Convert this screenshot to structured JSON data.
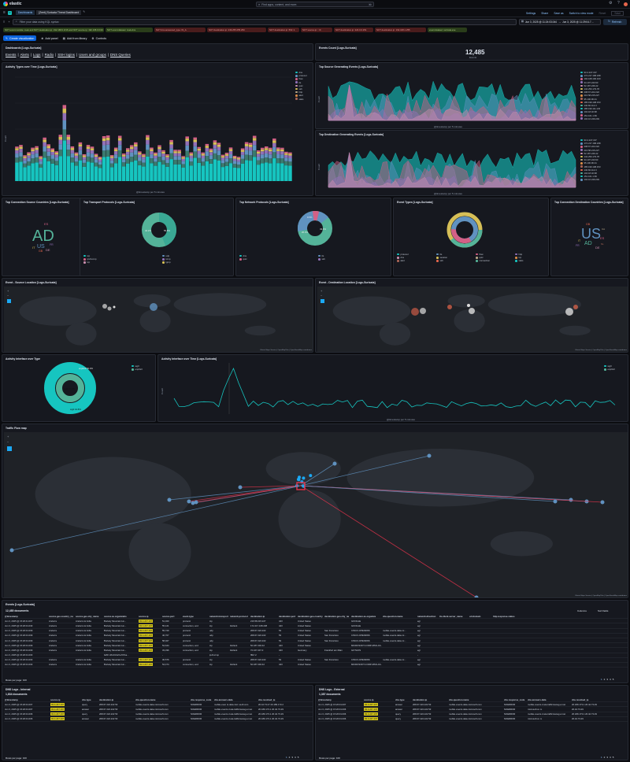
{
  "app": {
    "logo": "elastic",
    "search_placeholder": "Find apps, content, and more.",
    "shortcut": "⌘/"
  },
  "header": {
    "breadcrumb_home": "D",
    "breadcrumb_dashboards": "Dashboards",
    "breadcrumb_current": "[Zeek] Suricata Threat Dashboard",
    "links": [
      "Settings",
      "Share",
      "Save as",
      "Switch to view mode"
    ],
    "reset_label": "Reset",
    "save_label": "Save"
  },
  "query": {
    "placeholder": "Filter your data using KQL syntax",
    "date_start": "Jun 3, 2025 @ 11:24:03.044",
    "date_arrow": "→",
    "date_end": "Jun 3, 2025 @ 11:29:04.7…",
    "refresh_label": "Refresh"
  },
  "filters": [
    "NOT event.module: zeek and NOT destination.ip: 192.168.0.0/16 and NOT source.ip: 192.168.0.0/16",
    "NOT event.dataset: zeek.dns",
    "NOT dns.answered_type: IN_A",
    "NOT destination.ip: 239.255.255.250",
    "NOT destination.ip: ff02::1",
    "NOT source.ip: ::/0",
    "NOT destination.ip: 224.0.0.251",
    "NOT destination.ip: 192.168.1.255",
    "event.dataset: suricata.eve"
  ],
  "toolbar": {
    "create": "Create visualization",
    "add_panel": "Add panel",
    "add_library": "Add from library",
    "controls": "Controls"
  },
  "nav_panel": {
    "title": "Dashboards [Logs-Suricata]",
    "links": [
      "Events",
      "Alerts",
      "Logs",
      "Radio",
      "SSH logins",
      "Users and groups",
      "DNS Queries"
    ]
  },
  "metric_panel": {
    "title": "Events Count [Logs-Suricata]",
    "value": "12,485",
    "label": "Events"
  },
  "activity_panel": {
    "title": "Activity Types over Time [Logs-Suricata]",
    "xlabel": "@timestamp per 5 minutes",
    "ylabel": "Count"
  },
  "src_panel": {
    "title": "Top Source Generating Events [Logs-Suricata]",
    "xlabel": "@timestamp per 5 minutes",
    "ylabel": "Count"
  },
  "dst_panel": {
    "title": "Top Destination Generating Events [Logs-Suricata]",
    "xlabel": "@timestamp per 5 minutes",
    "ylabel": "Count"
  },
  "donuts": [
    {
      "title": "Top Connection Source Countries [Logs-Suricata]",
      "kind": "cloud",
      "words": [
        "AD",
        "US",
        "IT",
        "DE",
        "ES",
        "FR",
        "GB"
      ]
    },
    {
      "title": "Top Transport Protocols [Logs-Suricata]",
      "kind": "pie",
      "legend": [
        "tcp",
        "udp",
        "ipv6-icmp",
        "icmp",
        "tcp",
        "igmp"
      ],
      "center": "42.2%",
      "pct": "55.8%"
    },
    {
      "title": "Top Network Protocols [Logs-Suricata]",
      "kind": "pie",
      "legend": [
        "dns",
        "tls",
        "quic",
        "ssh"
      ],
      "pct1": "26.3%",
      "pct2": "43.4%",
      "pct3": "9.5%"
    },
    {
      "title": "Event Types [Logs-Suricata]",
      "kind": "multi",
      "legend": [
        "protocol",
        "tls",
        "flow",
        "http",
        "dns",
        "session",
        "quic",
        "tcp",
        "alert",
        "ssh",
        "connection",
        "stats"
      ]
    },
    {
      "title": "Top Connection Destination Countries [Logs-Suricata]",
      "kind": "cloud",
      "words": [
        "US",
        "AD",
        "ES",
        "DE",
        "IT",
        "FR",
        "GB",
        "NL",
        "CA"
      ]
    }
  ],
  "maps": [
    {
      "title": "Event - Source Location [Logs-Suricata]",
      "attrib": "Elastic Maps Service | OpenMapTiles | OpenStreetMap contributors"
    },
    {
      "title": "Event - Destination Location [Logs-Suricata]",
      "attrib": "Elastic Maps Service | OpenMapTiles | OpenStreetMap contributors"
    }
  ],
  "interface_panel": {
    "title": "Activity Interface over Type",
    "legend": [
      "wg0",
      "enp0s3"
    ],
    "outer": "enp0s3 52.4%",
    "inner": "wg0 97.2%",
    "big": "wg0 44.8%"
  },
  "interface_time": {
    "title": "Activity Interface over Time [Logs-Suricata]",
    "xlabel": "@timestamp per 5 minutes",
    "ylabel": "Count",
    "legend": [
      "wg0",
      "enp0s3"
    ]
  },
  "traffic_map": {
    "title": "Traffic Flow map",
    "attrib": "Elastic Maps Service | OpenMapTiles | OpenStreetMap contributors"
  },
  "events_table": {
    "title": "Events [Logs-Suricata]",
    "count": "12,485 documents",
    "columns_label": "Columns",
    "sort_label": "Sort fields",
    "headers": [
      "@timestamp",
      "source.geo.country_na",
      "source.geo.city_name",
      "source.as.organizatio",
      "source.ip",
      "source.port",
      "event.type",
      "network.transport",
      "network.protocol",
      "destination.ip",
      "destination.port",
      "destination.geo.country",
      "destination.geo.city_na",
      "destination.as.organiza",
      "dns.question.name",
      "network.direction",
      "tls.client.server_name",
      "url.domain",
      "http.response.status"
    ],
    "rows": [
      [
        "Jun 3, 2025 @ 15:26:41.007",
        "Andorra",
        "Andorra la Vella",
        "Borkely Mountain Ho...",
        "93.4.247.167",
        "51,320",
        "protocol",
        "tcp",
        "",
        "216.58.215.227",
        "443",
        "United States",
        "",
        "GOOGLE",
        "",
        "egr",
        "",
        "",
        ""
      ],
      [
        "Jun 3, 2025 @ 15:26:01.030",
        "Andorra",
        "Andorra la Vella",
        "Borkely Mountain Ho...",
        "93.4.247.167",
        "55,121",
        "connection, end",
        "tcp",
        "tlsclient",
        "172.217.168.238",
        "443",
        "United States",
        "",
        "GOOGLE",
        "",
        "egr",
        "",
        "",
        ""
      ],
      [
        "Jun 3, 2025 @ 15:26:01.009",
        "Andorra",
        "Andorra la Vella",
        "Borkely Mountain Ho...",
        "93.4.247.167",
        "55,729",
        "protocol",
        "udp",
        "",
        "208.67.222.222",
        "53",
        "United States",
        "San Francisco",
        "CISCO-OPENDNS",
        "mobile.events.data.mi...",
        "egr",
        "",
        "",
        ""
      ],
      [
        "Jun 3, 2025 @ 15:26:01.009",
        "Andorra",
        "Andorra la Vella",
        "Borkely Mountain Ho...",
        "93.4.247.167",
        "46,707",
        "protocol",
        "udp",
        "",
        "208.67.222.222",
        "53",
        "United States",
        "San Francisco",
        "CISCO-OPENDNS",
        "mobile.events.data.mi...",
        "egr",
        "",
        "",
        ""
      ],
      [
        "Jun 3, 2025 @ 15:26:01.009",
        "Andorra",
        "Andorra la Vella",
        "Borkely Mountain Ho...",
        "93.4.247.167",
        "58,027",
        "protocol",
        "udp",
        "",
        "208.67.222.222",
        "53",
        "United States",
        "San Francisco",
        "CISCO-OPENDNS",
        "mobile.events.data.mi...",
        "egr",
        "",
        "",
        ""
      ],
      [
        "Jun 3, 2025 @ 15:26:01.009",
        "Andorra",
        "Andorra la Vella",
        "Borkely Mountain Ho...",
        "93.4.247.167",
        "54,644",
        "connection, end",
        "tcp",
        "tlsclient",
        "52.187.246.42",
        "443",
        "United States",
        "",
        "MICROSOFT-CORP-MSN-AS...",
        "",
        "egr",
        "",
        "",
        ""
      ],
      [
        "Jun 3, 2025 @ 15:26:01.009",
        "Andorra",
        "Andorra la Vella",
        "Borkely Mountain Ho...",
        "93.4.247.167",
        "33,336",
        "connection, end",
        "tcp",
        "tlsclient",
        "72.167.247.3",
        "443",
        "Germany",
        "Frankfurt am Main",
        "GOTHOS",
        "",
        "egr",
        "",
        "",
        ""
      ],
      [
        "Jun 3, 2025 @ 15:26:01.003",
        "",
        "",
        "fe80::c8c4:b0e5:e5f:f1a...",
        "",
        "-",
        "",
        "ipv6-icmp",
        "",
        "ff02::2",
        "-",
        "",
        "",
        "",
        "",
        "-",
        "",
        "",
        ""
      ],
      [
        "Jun 3, 2025 @ 15:26:01.003",
        "Andorra",
        "Andorra la Vella",
        "Borkely Mountain Ho...",
        "93.4.247.167",
        "36,576",
        "protocol",
        "tcp",
        "",
        "208.67.222.222",
        "53",
        "United States",
        "San Francisco",
        "CISCO-OPENDNS",
        "mobile.events.data.mi...",
        "egr",
        "",
        "",
        ""
      ],
      [
        "Jun 3, 2025 @ 15:26:01.003",
        "Andorra",
        "Andorra la Vella",
        "Borkely Mountain Ho...",
        "93.4.247.167",
        "54,474",
        "connection, end",
        "tcp",
        "tlsclient",
        "52.187.246.42",
        "443",
        "United States",
        "",
        "MICROSOFT-CORP-MSN-AS...",
        "",
        "egr",
        "",
        "",
        ""
      ]
    ],
    "rows_per_page": "Rows per page: 100",
    "pages": [
      "1",
      "2",
      "3",
      "4",
      "5"
    ]
  },
  "dns_internal": {
    "title": "DNS Logs - Internal",
    "count": "1,834 documents",
    "headers": [
      "@timestamp",
      "source.ip",
      "dns.type",
      "destination.ip",
      "dns.question.name",
      "dns.response_code",
      "dns.answers.data",
      "dns.resolved_ip"
    ],
    "rows": [
      [
        "Jun 3, 2025 @ 15:26:01.007",
        "93.4.247.167",
        "query",
        "208.67.222.222 53",
        "mobile.events.data.microsoft.com",
        "NOERROR",
        "mobile-even ts.data.micr osoft.com",
        "20.42.73.27 20.189.173.2"
      ],
      [
        "Jun 3, 2025 @ 15:26:01.007",
        "93.4.247.167",
        "answer",
        "208.67.222.222 53",
        "mobile.events.data.microsoft.com",
        "NOERROR",
        "mobile.events.d ata.trafficmanag er.net",
        "20.189.173.1 20.42.73.29"
      ],
      [
        "Jun 3, 2025 @ 15:26:01.006",
        "93.4.247.167",
        "query",
        "208.67.222.222 53",
        "mobile.events.data.microsoft.com",
        "NOERROR",
        "mobile.events.d ata.trafficmanag er.net",
        "20.189.173.1 20.42.73.29"
      ],
      [
        "Jun 3, 2025 @ 15:26:01.006",
        "93.4.247.167",
        "answer",
        "208.67.222.222 53",
        "mobile.events.data.microsoft.com",
        "NOERROR",
        "mobile.events.d ata.trafficmanag er.net",
        "20.189.173.1 20.42.73.29"
      ]
    ],
    "rows_per_page": "Rows per page: 100",
    "pages": [
      "1",
      "2",
      "3",
      "4",
      "5"
    ]
  },
  "dns_external": {
    "title": "DNS Logs - External",
    "count": "1,387 documents",
    "headers": [
      "@timestamp",
      "source.ip",
      "dns.type",
      "destination.ip",
      "dns.question.name",
      "dns.response_code",
      "dns.answers.data",
      "dns.resolved_ip"
    ],
    "rows": [
      [
        "Jun 3, 2025 @ 15:26:01.007",
        "93.4.247.167",
        "answer",
        "208.67.222.222 53",
        "mobile.events.data.microsoft.com",
        "NOERROR",
        "mobile.events.d ata.trafficmanag er.net",
        "20.189.173.1 20.42.73.29"
      ],
      [
        "Jun 3, 2025 @ 15:26:01.006",
        "93.4.247.167",
        "answer",
        "208.67.222.222 53",
        "mobile.events.data.microsoft.com",
        "NOERROR",
        "microsoft.co m",
        "20.42.73.29"
      ],
      [
        "Jun 3, 2025 @ 15:26:01.006",
        "93.4.247.167",
        "query",
        "208.67.222.222 53",
        "mobile.events.data.microsoft.com",
        "NOERROR",
        "mobile.events.d ata.trafficmanag er.net",
        "20.189.173.1 20.42.73.29"
      ],
      [
        "Jun 3, 2025 @ 15:26:01.006",
        "93.4.247.167",
        "query",
        "208.67.222.222 53",
        "mobile.events.data.microsoft.com",
        "NOERROR",
        "microsoft.co m",
        "20.42.73.29"
      ]
    ],
    "rows_per_page": "Rows per page: 100",
    "pages": [
      "1",
      "2",
      "3",
      "4",
      "5"
    ]
  },
  "colors": {
    "accent": "#0b64dd",
    "teal": "#16c5c0",
    "bg": "#0b0c10",
    "panel": "#16181f"
  }
}
